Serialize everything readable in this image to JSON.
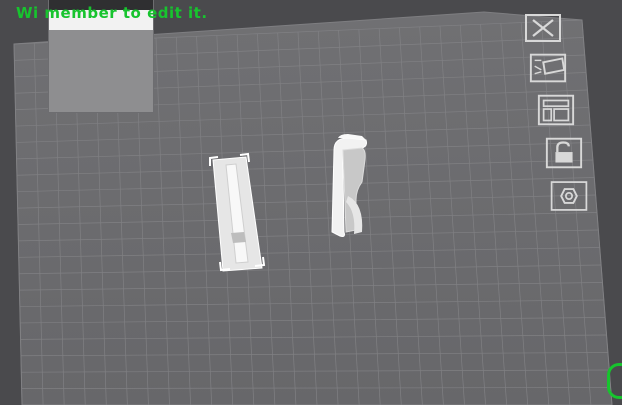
{
  "hint": {
    "text": "Wi           member to edit it.",
    "color": "#17c42e"
  },
  "preview": {
    "band_color": "#f2f2f2",
    "body_color": "#8e8e90"
  },
  "toolbar": {
    "tools": [
      {
        "name": "close-icon"
      },
      {
        "name": "edit-label-icon"
      },
      {
        "name": "layout-icon"
      },
      {
        "name": "unlock-icon"
      },
      {
        "name": "settings-icon"
      }
    ]
  },
  "colors": {
    "background": "#4a4a4d",
    "plate": "#6e6e71",
    "grid": "#828285",
    "model": "#e9e9e9",
    "accent": "#17c42e"
  }
}
